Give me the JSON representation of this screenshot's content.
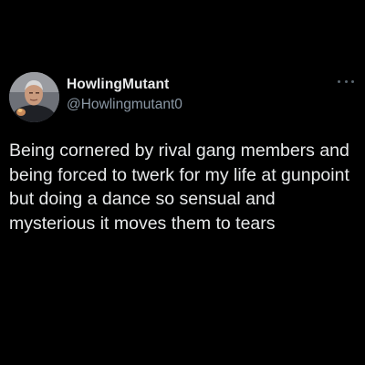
{
  "tweet": {
    "author": {
      "display_name": "HowlingMutant",
      "handle": "@Howlingmutant0",
      "avatar_icon": "profile-photo"
    },
    "menu_icon": "more-options-icon",
    "text": "Being cornered by rival gang members and being forced to twerk for my life at gunpoint but doing a dance so sensual and mysterious it moves them to tears"
  },
  "colors": {
    "background": "#000000",
    "primary_text": "#e7e9ea",
    "secondary_text": "#8b98a5"
  }
}
